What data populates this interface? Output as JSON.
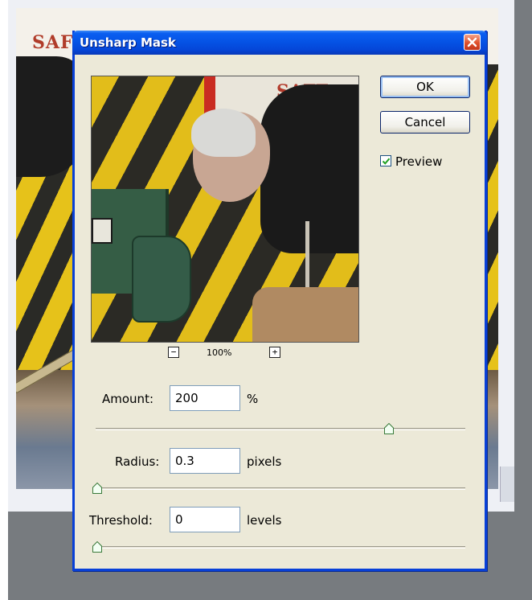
{
  "dialog": {
    "title": "Unsharp Mask",
    "ok_label": "OK",
    "cancel_label": "Cancel",
    "preview_label": "Preview",
    "preview_checked": true,
    "zoom": {
      "minus": "−",
      "plus": "+",
      "percent": "100%"
    },
    "amount": {
      "label": "Amount:",
      "value": "200",
      "unit": "%",
      "slider_fraction": 0.81
    },
    "radius": {
      "label": "Radius:",
      "value": "0.3",
      "unit": "pixels",
      "slider_fraction": 0.0
    },
    "threshold": {
      "label": "Threshold:",
      "value": "0",
      "unit": "levels",
      "slider_fraction": 0.0
    }
  },
  "background_canvas": {
    "visible_text": "SAFF"
  },
  "colors": {
    "titlebar": "#0552e4",
    "dialog_bg": "#ece9d8",
    "close_button": "#e0502c",
    "thumb_fill": "#f3fff3",
    "thumb_border": "#3a7a3a"
  },
  "icons": [
    "close-icon",
    "checkmark-icon",
    "zoom-out-icon",
    "zoom-in-icon",
    "slider-thumb-icon"
  ]
}
